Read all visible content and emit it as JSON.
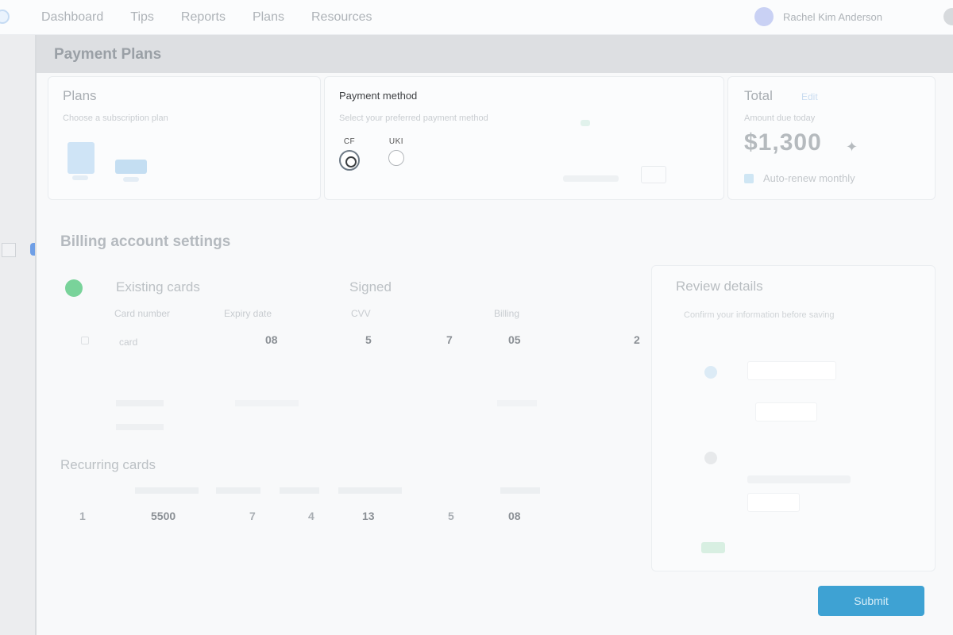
{
  "topbar": {
    "nav": [
      "Dashboard",
      "Tips",
      "Reports",
      "Plans",
      "Resources"
    ],
    "user_name": "Rachel Kim Anderson"
  },
  "page": {
    "title": "Payment Plans"
  },
  "plan_card": {
    "title": "Plans",
    "subtitle": "Choose a subscription plan"
  },
  "payment_card": {
    "title": "Payment method",
    "subtitle": "Select your preferred payment method",
    "options": [
      {
        "label": "CF",
        "checked": true
      },
      {
        "label": "UKI",
        "checked": false
      }
    ]
  },
  "summary_card": {
    "title": "Total",
    "tag": "Edit",
    "subtitle": "Amount due today",
    "amount": "$1,300",
    "checkbox_label": "Auto-renew monthly"
  },
  "billing": {
    "section_title": "Billing account settings",
    "existing_title": "Existing cards",
    "signed_title": "Signed",
    "col_headers": [
      "Card number",
      "Expiry date",
      "CVV",
      "Billing"
    ],
    "row1": [
      "card",
      "08",
      "5",
      "7",
      "05",
      "2"
    ],
    "recurring_title": "Recurring cards",
    "recurring_row": [
      "1",
      "5500",
      "7",
      "4",
      "13",
      "5",
      "08"
    ]
  },
  "side_card": {
    "title": "Review details",
    "subtitle": "Confirm your information before saving"
  },
  "cta": {
    "label": "Submit"
  },
  "colors": {
    "accent": "#3ea2d3",
    "success": "#79d39a",
    "brand": "#6f9fe6"
  }
}
